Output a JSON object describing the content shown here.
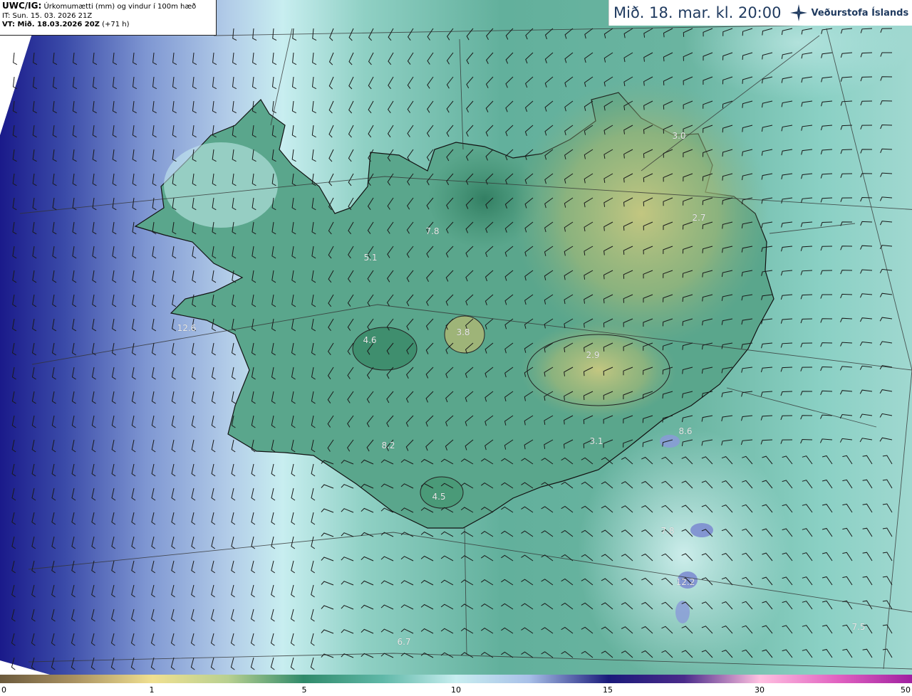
{
  "header": {
    "model_code": "UWC/IG:",
    "title": "Úrkomumætti (mm) og vindur í 100m hæð",
    "init_time": "IT: Sun. 15. 03. 2026 21Z",
    "valid_prefix": "VT: Mið. 18.03.2026 20Z",
    "lead": "(+71 h)"
  },
  "valid_time_banner": "Mið. 18. mar. kl. 20:00",
  "logo": {
    "text": "Veðurstofa Íslands",
    "icon": "vedurstofa-logo-icon"
  },
  "colorbar": {
    "ticks": [
      "0",
      "1",
      "5",
      "10",
      "15",
      "30",
      "50"
    ],
    "colors": [
      "#6b5a3c",
      "#b8a060",
      "#f0e090",
      "#a8c890",
      "#2f8a6a",
      "#7fd0c8",
      "#c8eef0",
      "#a8c0e8",
      "#6070c0",
      "#1a1a7a",
      "#6a2a9a",
      "#c040c0",
      "#ffa0ff"
    ]
  },
  "map_values": [
    {
      "id": "v1",
      "text": "3.0"
    },
    {
      "id": "v2",
      "text": "2.7"
    },
    {
      "id": "v3",
      "text": "7.8"
    },
    {
      "id": "v4",
      "text": "5.1"
    },
    {
      "id": "v5",
      "text": "3.8"
    },
    {
      "id": "v6",
      "text": "4.6"
    },
    {
      "id": "v7",
      "text": "2.9"
    },
    {
      "id": "v8",
      "text": "12.6"
    },
    {
      "id": "v9",
      "text": "8.2"
    },
    {
      "id": "v10",
      "text": "3.1"
    },
    {
      "id": "v11",
      "text": "4.5"
    },
    {
      "id": "v12",
      "text": "8.6"
    },
    {
      "id": "v13",
      "text": "7.8"
    },
    {
      "id": "v14",
      "text": "12.2"
    },
    {
      "id": "v15",
      "text": "6.7"
    },
    {
      "id": "v16",
      "text": "7.5"
    }
  ],
  "legend_colors": {
    "ocean_high": "#1a1a8a",
    "ocean_mid": "#a8c8e8",
    "ocean_light": "#c8eef0",
    "teal": "#6ab8a8",
    "land_green": "#4a9a78",
    "land_yellow": "#b0b878",
    "outline": "#111111"
  }
}
